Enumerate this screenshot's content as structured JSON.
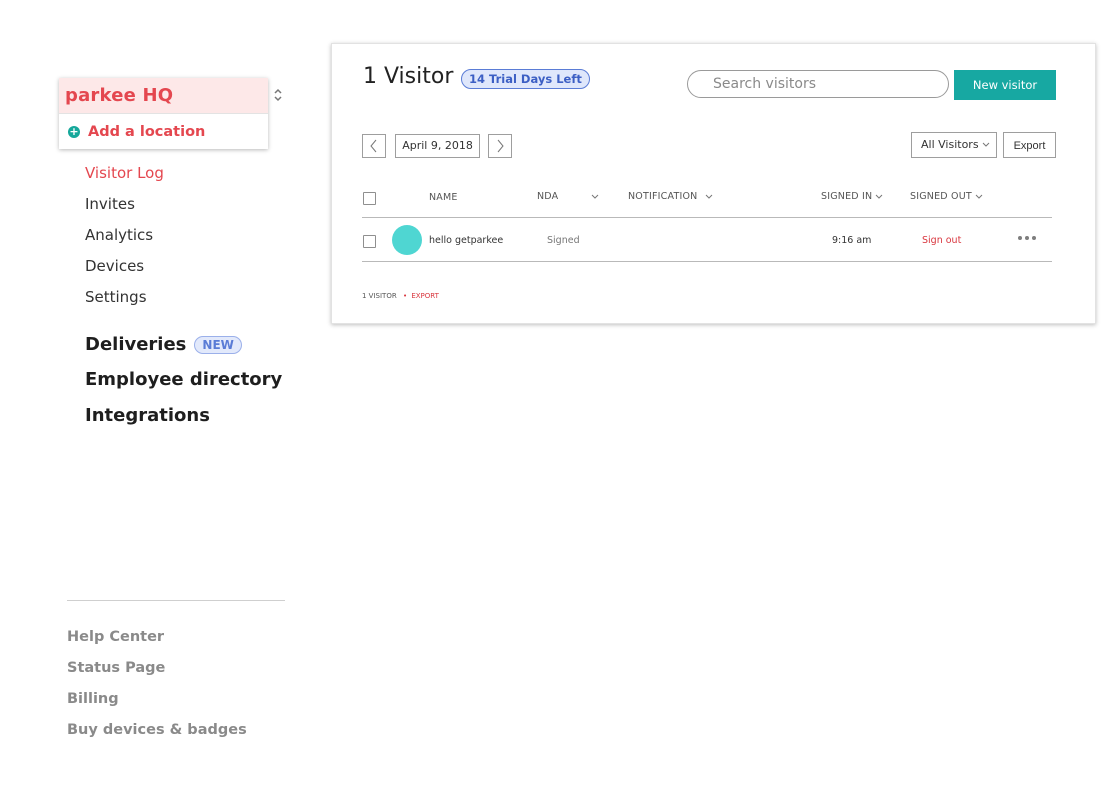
{
  "sidebar": {
    "location": {
      "current": "parkee HQ",
      "add_label": "Add a location"
    },
    "nav": [
      "Visitor Log",
      "Invites",
      "Analytics",
      "Devices",
      "Settings"
    ],
    "sections": {
      "deliveries": "Deliveries",
      "new_badge": "NEW",
      "employee_directory": "Employee directory",
      "integrations": "Integrations"
    },
    "footer_links": [
      "Help Center",
      "Status Page",
      "Billing",
      "Buy devices & badges"
    ]
  },
  "main": {
    "title": "1 Visitor",
    "trial_badge": "14 Trial Days Left",
    "search": {
      "placeholder": "Search visitors"
    },
    "new_visitor_label": "New visitor",
    "date": "April 9, 2018",
    "filter": "All Visitors",
    "export_label": "Export",
    "columns": [
      "NAME",
      "NDA",
      "NOTIFICATION",
      "SIGNED IN",
      "SIGNED OUT"
    ],
    "rows": [
      {
        "name": "hello getparkee",
        "nda": "Signed",
        "notification": "",
        "signed_in": "9:16 am",
        "signed_out": "Sign out"
      }
    ],
    "footer": {
      "count": "1 VISITOR",
      "separator": "•",
      "export": "EXPORT"
    }
  },
  "colors": {
    "accent_red": "#e4474f",
    "teal": "#17a8a2",
    "avatar": "#4fd6d2",
    "badge_blue": "#5a7cd6"
  }
}
